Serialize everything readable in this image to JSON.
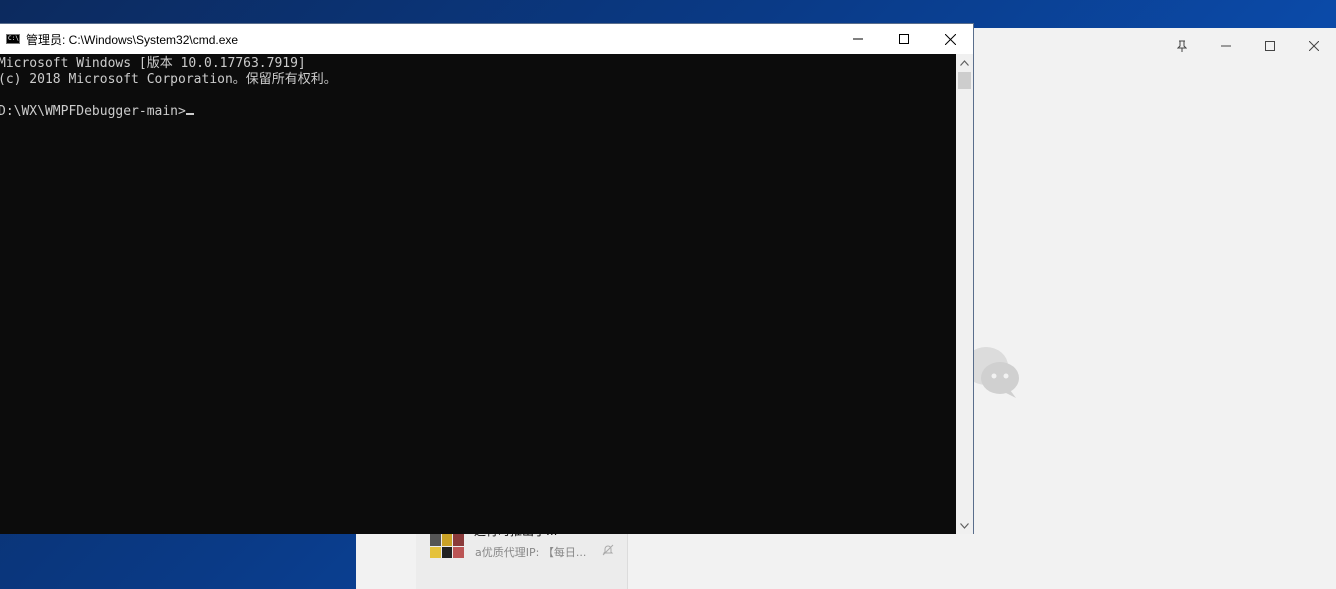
{
  "cmd": {
    "title": "管理员: C:\\Windows\\System32\\cmd.exe",
    "icon_text": "C:\\",
    "lines": [
      "Microsoft Windows [版本 10.0.17763.7919]",
      "(c) 2018 Microsoft Corporation。保留所有权利。",
      "",
      "D:\\WX\\WMPFDebugger-main>"
    ],
    "icons": {
      "minimize": "minimize-icon",
      "maximize": "maximize-icon",
      "close": "close-icon",
      "scroll_up": "chevron-up-icon",
      "scroll_down": "chevron-down-icon"
    }
  },
  "wechat": {
    "chat_item": {
      "title": "运行时推出了...",
      "preview": "a优质代理IP: 【每日...",
      "mute_icon": "mute-bell-icon"
    },
    "controls": {
      "pin": "pin-icon",
      "minimize": "minimize-icon",
      "maximize": "maximize-icon",
      "close": "close-icon"
    },
    "logo_icon": "wechat-logo-icon"
  },
  "colors": {
    "console_bg": "#0c0c0c",
    "console_text": "#cccccc",
    "desktop_bg": "#0a3a86",
    "wechat_bg": "#f2f2f2"
  }
}
